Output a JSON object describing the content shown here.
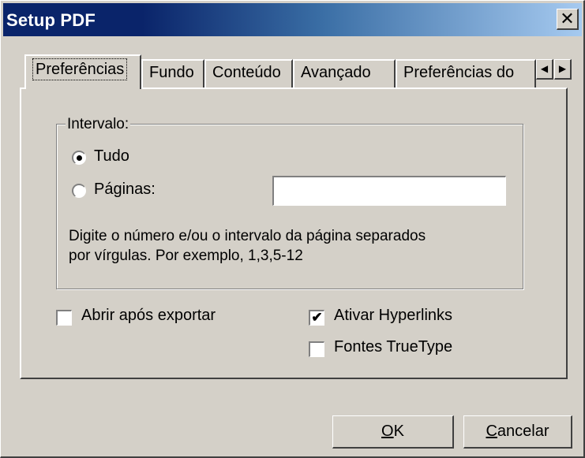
{
  "window": {
    "title": "Setup PDF",
    "close_glyph": "✕"
  },
  "tabs": [
    {
      "label": "Preferências",
      "active": true
    },
    {
      "label": "Fundo"
    },
    {
      "label": "Conteúdo"
    },
    {
      "label": "Avançado"
    },
    {
      "label": "Preferências do"
    }
  ],
  "tab_scroll": {
    "left_icon": "scroll-left-arrow",
    "right_icon": "scroll-right-arrow",
    "left_glyph": "◀",
    "right_glyph": "▶"
  },
  "range_group": {
    "label": "Intervalo:",
    "options": [
      {
        "label": "Tudo",
        "selected": true
      },
      {
        "label": "Páginas:",
        "selected": false
      }
    ],
    "pages_input_value": "",
    "hint_line1": "Digite o número e/ou o intervalo da página separados",
    "hint_line2": "por vírgulas. Por exemplo, 1,3,5-12"
  },
  "checkboxes": {
    "open_after_export": {
      "label": "Abrir após exportar",
      "checked": false
    },
    "enable_hyperlinks": {
      "label": "Ativar Hyperlinks",
      "checked": true
    },
    "truetype_fonts": {
      "label": "Fontes TrueType",
      "checked": false
    },
    "check_glyph": "✔"
  },
  "buttons": {
    "ok": {
      "accel": "O",
      "rest": "K"
    },
    "cancel": {
      "accel": "C",
      "rest": "ancelar"
    }
  }
}
